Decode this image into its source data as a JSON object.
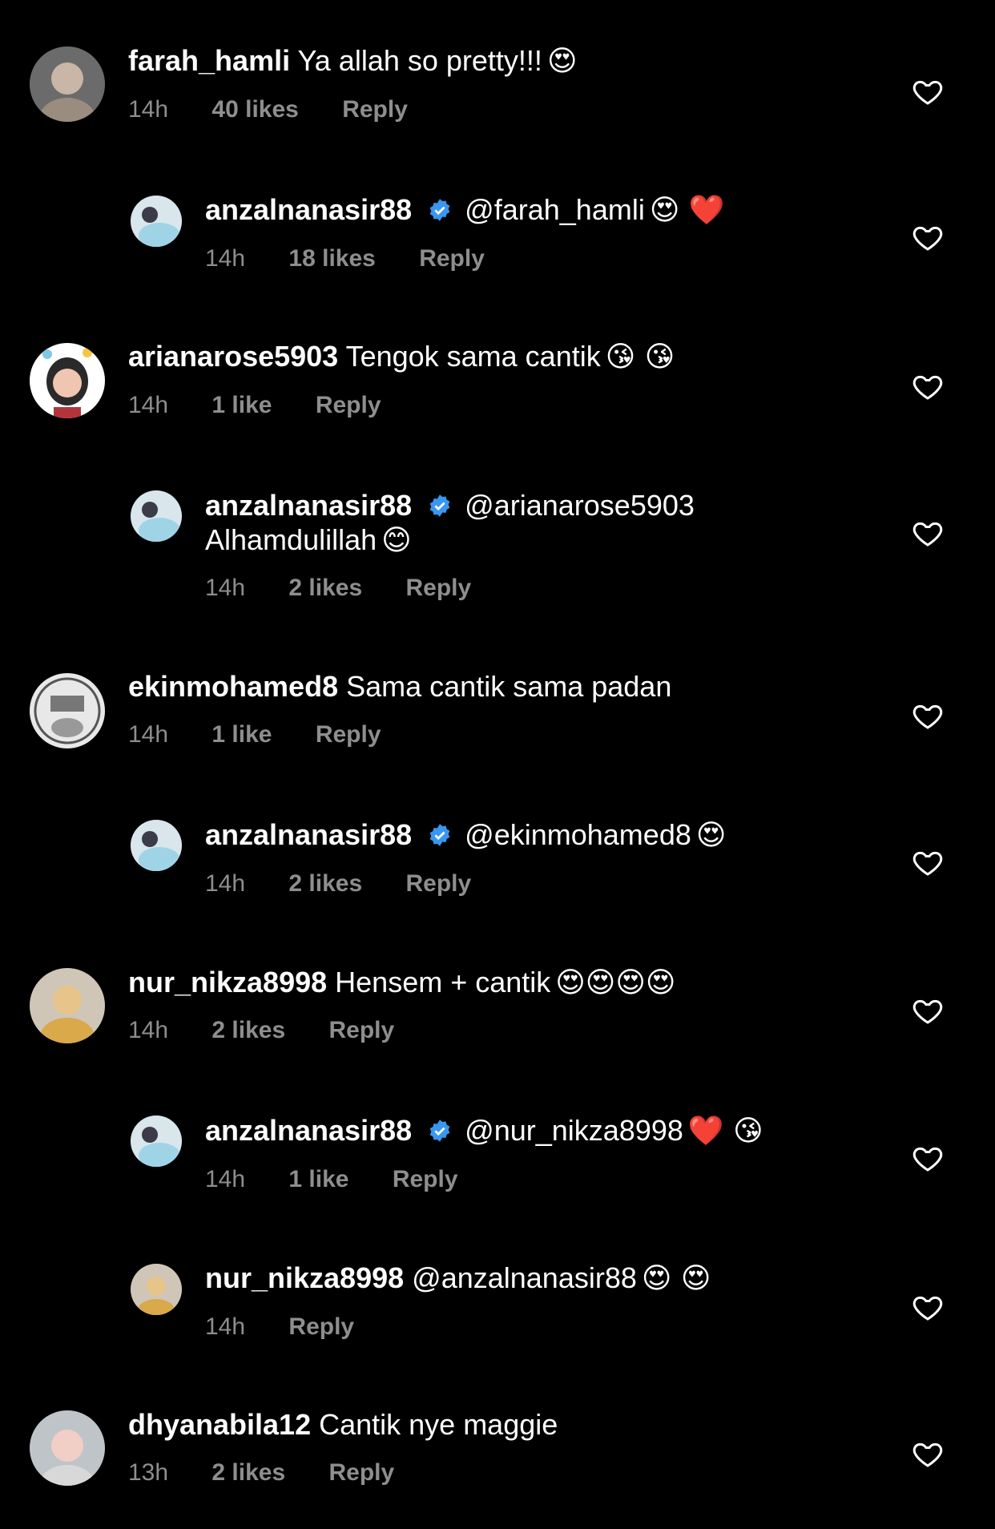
{
  "comments": [
    {
      "user": "farah_hamli",
      "text": "Ya allah so pretty!!!",
      "emoji": "😍",
      "time": "14h",
      "likes": "40 likes",
      "reply": "Reply"
    },
    {
      "user": "anzalnanasir88",
      "text": "@farah_hamli",
      "emoji": "😍 ❤️",
      "time": "14h",
      "likes": "18 likes",
      "reply": "Reply"
    },
    {
      "user": "arianarose5903",
      "text": "Tengok sama cantik",
      "emoji": "😘 😘",
      "time": "14h",
      "likes": "1 like",
      "reply": "Reply"
    },
    {
      "user": "anzalnanasir88",
      "text": "@arianarose5903",
      "text2": "Alhamdulillah",
      "emoji": "😊",
      "time": "14h",
      "likes": "2 likes",
      "reply": "Reply"
    },
    {
      "user": "ekinmohamed8",
      "text": "Sama cantik sama padan",
      "time": "14h",
      "likes": "1 like",
      "reply": "Reply"
    },
    {
      "user": "anzalnanasir88",
      "text": "@ekinmohamed8",
      "emoji": "😍",
      "time": "14h",
      "likes": "2 likes",
      "reply": "Reply"
    },
    {
      "user": "nur_nikza8998",
      "text": "Hensem + cantik",
      "emoji": "😍😍😍😍",
      "time": "14h",
      "likes": "2 likes",
      "reply": "Reply"
    },
    {
      "user": "anzalnanasir88",
      "text": "@nur_nikza8998",
      "emoji": "❤️ 😘",
      "time": "14h",
      "likes": "1 like",
      "reply": "Reply"
    },
    {
      "user": "nur_nikza8998",
      "text": "@anzalnanasir88",
      "emoji": "😍 😍",
      "time": "14h",
      "reply": "Reply"
    },
    {
      "user": "dhyanabila12",
      "text": "Cantik nye maggie",
      "time": "13h",
      "likes": "2 likes",
      "reply": "Reply"
    }
  ],
  "icons": {
    "like": "heart-outline-icon",
    "verified": "verified-badge-icon"
  },
  "colors": {
    "background": "#000000",
    "text": "#ffffff",
    "meta": "#8e8e8e",
    "verified": "#3897f0"
  }
}
